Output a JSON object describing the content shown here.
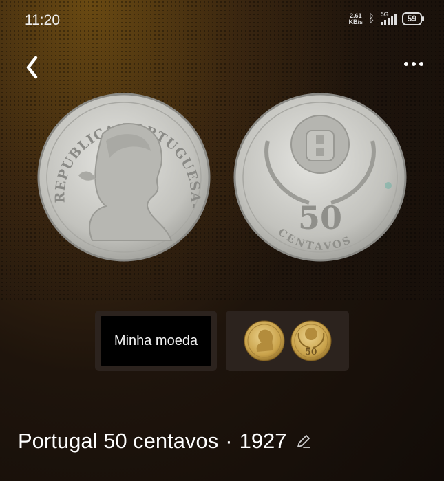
{
  "status": {
    "time": "11:20",
    "net_speed_value": "2.61",
    "net_speed_unit": "KB/s",
    "network": "5G",
    "battery": "59"
  },
  "toolbar": {
    "back_icon": "chevron-left-icon",
    "more_icon": "more-dots-icon"
  },
  "coin_images": {
    "obverse_legend": "REPUBLICA PORTUGUESA-1927",
    "reverse_value": "50",
    "reverse_legend": "CENTAVOS"
  },
  "cards": {
    "my_coin_label": "Minha moeda",
    "thumb_value": "50"
  },
  "coin": {
    "title": "Portugal 50 centavos",
    "separator": "·",
    "year": "1927",
    "edit_icon": "pencil-icon"
  },
  "colors": {
    "coin_silver": "#c9c9c4",
    "coin_gold": "#c9a24a",
    "card_bg": "#2c231e"
  }
}
